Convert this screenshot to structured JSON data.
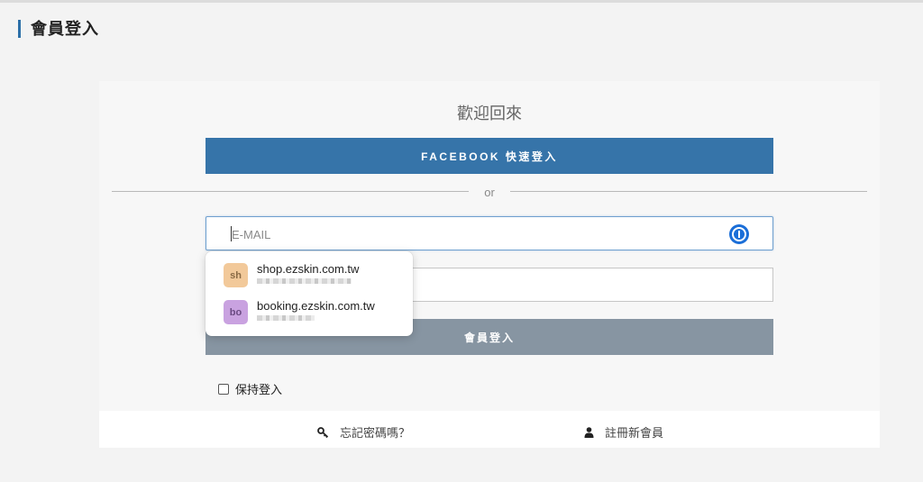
{
  "page": {
    "title": "會員登入"
  },
  "card": {
    "welcome": "歡迎回來",
    "facebook_button": "FACEBOOK 快速登入",
    "divider_text": "or",
    "email": {
      "placeholder": "E-MAIL",
      "value": ""
    },
    "password": {
      "placeholder": "",
      "value": ""
    },
    "login_button": "會員登入",
    "remember_label": "保持登入"
  },
  "footer": {
    "forgot_label": "忘記密碼嗎？",
    "register_label": "註冊新會員"
  },
  "autofill": {
    "items": [
      {
        "avatar": "sh",
        "domain": "shop.ezskin.com.tw"
      },
      {
        "avatar": "bo",
        "domain": "booking.ezskin.com.tw"
      }
    ]
  },
  "colors": {
    "facebook": "#3674a9",
    "login_button": "#8795a2",
    "accent": "#2c6fa8",
    "password_manager": "#1a6ed8"
  },
  "icons": {
    "password_manager": "1password-icon",
    "forgot": "key-icon",
    "register": "user-icon"
  }
}
